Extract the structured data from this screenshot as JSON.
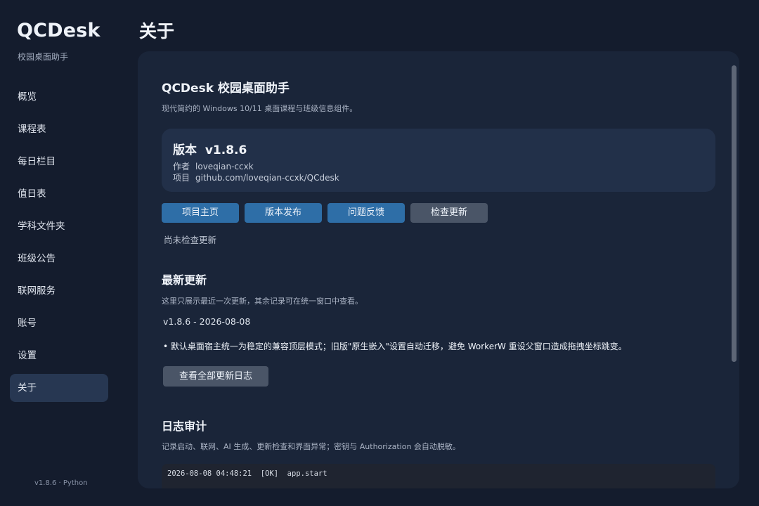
{
  "sidebar": {
    "brand": "QCDesk",
    "subtitle": "校园桌面助手",
    "items": [
      {
        "label": "概览"
      },
      {
        "label": "课程表"
      },
      {
        "label": "每日栏目"
      },
      {
        "label": "值日表"
      },
      {
        "label": "学科文件夹"
      },
      {
        "label": "班级公告"
      },
      {
        "label": "联网服务"
      },
      {
        "label": "账号"
      },
      {
        "label": "设置"
      },
      {
        "label": "关于",
        "active": true
      }
    ],
    "footer": "v1.8.6 · Python"
  },
  "page": {
    "title": "关于"
  },
  "about": {
    "app_name": "QCDesk 校园桌面助手",
    "description": "现代简约的 Windows 10/11 桌面课程与班级信息组件。",
    "version_label": "版本",
    "version": "v1.8.6",
    "author_label": "作者",
    "author": "loveqian-ccxk",
    "project_label": "项目",
    "project_url": "github.com/loveqian-ccxk/QCdesk",
    "buttons": {
      "homepage": "项目主页",
      "releases": "版本发布",
      "feedback": "问题反馈",
      "check_update": "检查更新"
    },
    "check_status": "尚未检查更新"
  },
  "latest_update": {
    "title": "最新更新",
    "description": "这里只展示最近一次更新，其余记录可在统一窗口中查看。",
    "version_date": "v1.8.6 - 2026-08-08",
    "note": "• 默认桌面宿主统一为稳定的兼容顶层模式；旧版\"原生嵌入\"设置自动迁移，避免 WorkerW 重设父窗口造成拖拽坐标跳变。",
    "view_all_button": "查看全部更新日志"
  },
  "log_audit": {
    "title": "日志审计",
    "description": "记录启动、联网、AI 生成、更新检查和界面异常；密钥与 Authorization 会自动脱敏。",
    "entries": [
      {
        "text": "2026-08-08 04:48:21  [OK]  app.start"
      }
    ]
  },
  "colors": {
    "background": "#141c2d",
    "panel": "#1a2539",
    "card": "#223049",
    "active_nav": "#273752",
    "primary_button": "#2e6ea7",
    "secondary_button": "#4a5567"
  }
}
